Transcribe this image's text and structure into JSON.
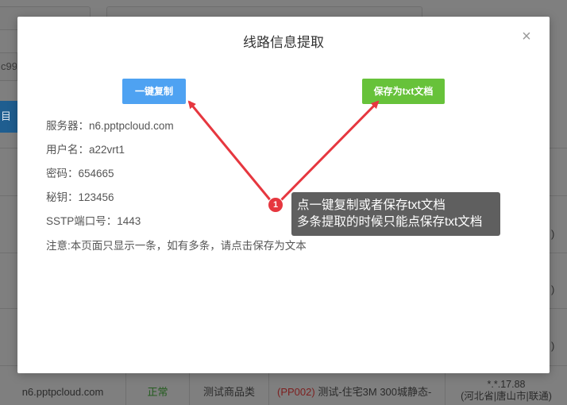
{
  "background": {
    "left_input_text": "c99",
    "left_button_label": "目",
    "paren": ")",
    "row": {
      "server": "n6.pptpcloud.com",
      "status": "正常",
      "type": "测试商品类",
      "product_code": "(PP002)",
      "product_name": " 测试-住宅3M 300城静态-",
      "ip_line1": "*.*.17.88",
      "ip_line2": "(河北省|唐山市|联通)"
    }
  },
  "modal": {
    "title": "线路信息提取",
    "close_icon": "close-icon",
    "copy_button": "一键复制",
    "save_button": "保存为txt文档",
    "fields": [
      {
        "label": "服务器：",
        "value": "n6.pptpcloud.com"
      },
      {
        "label": "用户名：",
        "value": "a22vrt1"
      },
      {
        "label": "密码：",
        "value": "654665"
      },
      {
        "label": "秘钥：",
        "value": "123456"
      },
      {
        "label": "SSTP端口号：",
        "value": "1443"
      }
    ],
    "notice": "注意:本页面只显示一条，如有多条，请点击保存为文本"
  },
  "annotation": {
    "badge": "1",
    "line1": "点一键复制或者保存txt文档",
    "line2": "多条提取的时候只能点保存txt文档",
    "color": "#e6373f"
  }
}
